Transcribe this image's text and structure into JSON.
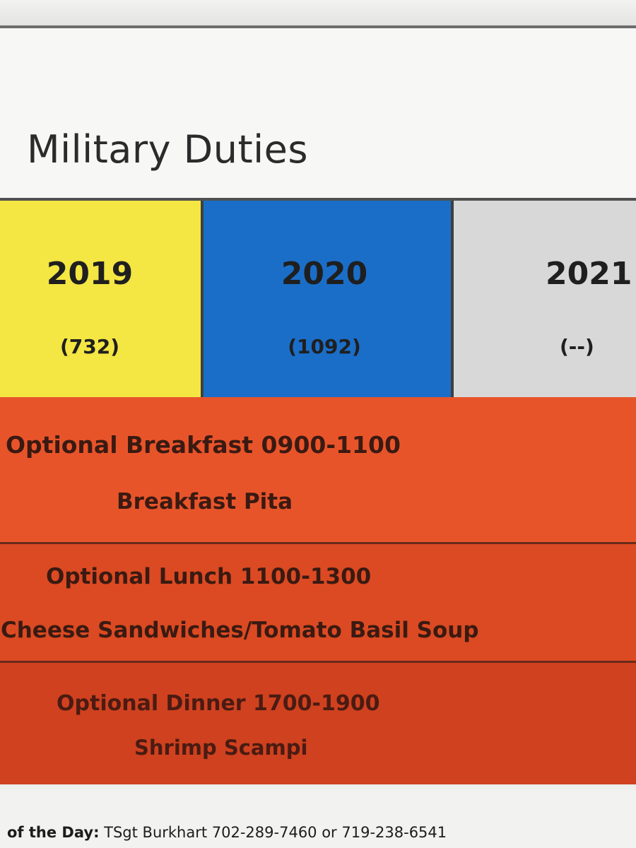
{
  "page": {
    "title": "Military Duties"
  },
  "years": [
    {
      "year": "2019",
      "count": "(732)",
      "color": "#f4e643"
    },
    {
      "year": "2020",
      "count": "(1092)",
      "color": "#1a6ec8"
    },
    {
      "year": "2021",
      "count": "(--)",
      "color": "#d8d8d8"
    }
  ],
  "meals": [
    {
      "title": "Optional Breakfast 0900-1100",
      "item": "Breakfast Pita"
    },
    {
      "title": "Optional Lunch 1100-1300",
      "item": "d Cheese Sandwiches/Tomato Basil Soup"
    },
    {
      "title": "Optional Dinner 1700-1900",
      "item": "Shrimp Scampi"
    }
  ],
  "footer": {
    "label": "of the Day:",
    "contact": " TSgt Burkhart 702-289-7460 or 719-238-6541"
  }
}
